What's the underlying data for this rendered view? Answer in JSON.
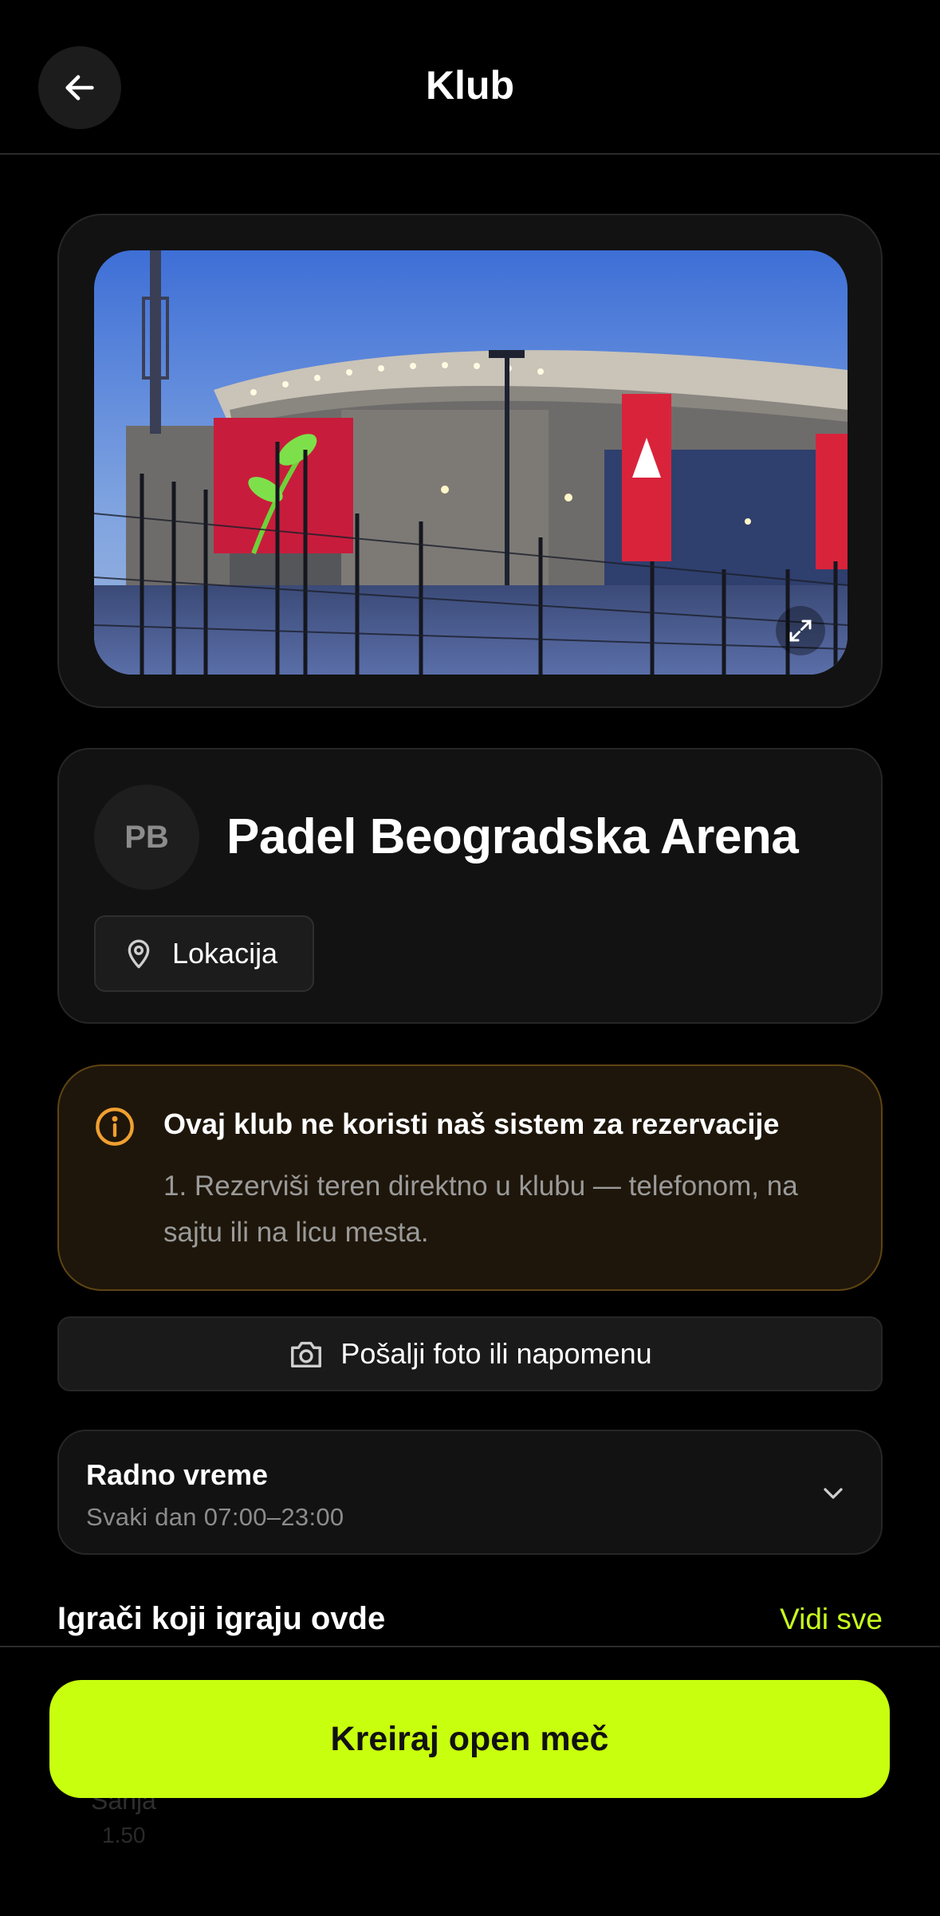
{
  "header": {
    "title": "Klub",
    "back_icon": "arrow-left-icon"
  },
  "image_card": {
    "expand_icon": "expand-icon"
  },
  "club": {
    "initials": "PB",
    "name": "Padel Beogradska Arena",
    "location_label": "Lokacija",
    "location_icon": "map-pin-icon"
  },
  "notice": {
    "icon": "info-icon",
    "title": "Ovaj klub ne koristi naš sistem za rezervacije",
    "text": "1. Rezerviši teren direktno u klubu — telefonom, na sajtu ili na licu mesta.",
    "accent_color": "#f0a030"
  },
  "photo_note": {
    "label": "Pošalji foto ili napomenu",
    "icon": "camera-icon"
  },
  "hours": {
    "title": "Radno vreme",
    "text": "Svaki dan 07:00–23:00",
    "icon": "chevron-down-icon"
  },
  "players": {
    "title": "Igrači koji igraju ovde",
    "see_all": "Vidi sve",
    "partial_player": {
      "name": "Sanja",
      "rating": "1.50"
    }
  },
  "cta": {
    "label": "Kreiraj open meč",
    "color": "#c8ff0f"
  },
  "colors": {
    "accent": "#c8ff1e",
    "background": "#000000",
    "card": "#121212"
  }
}
